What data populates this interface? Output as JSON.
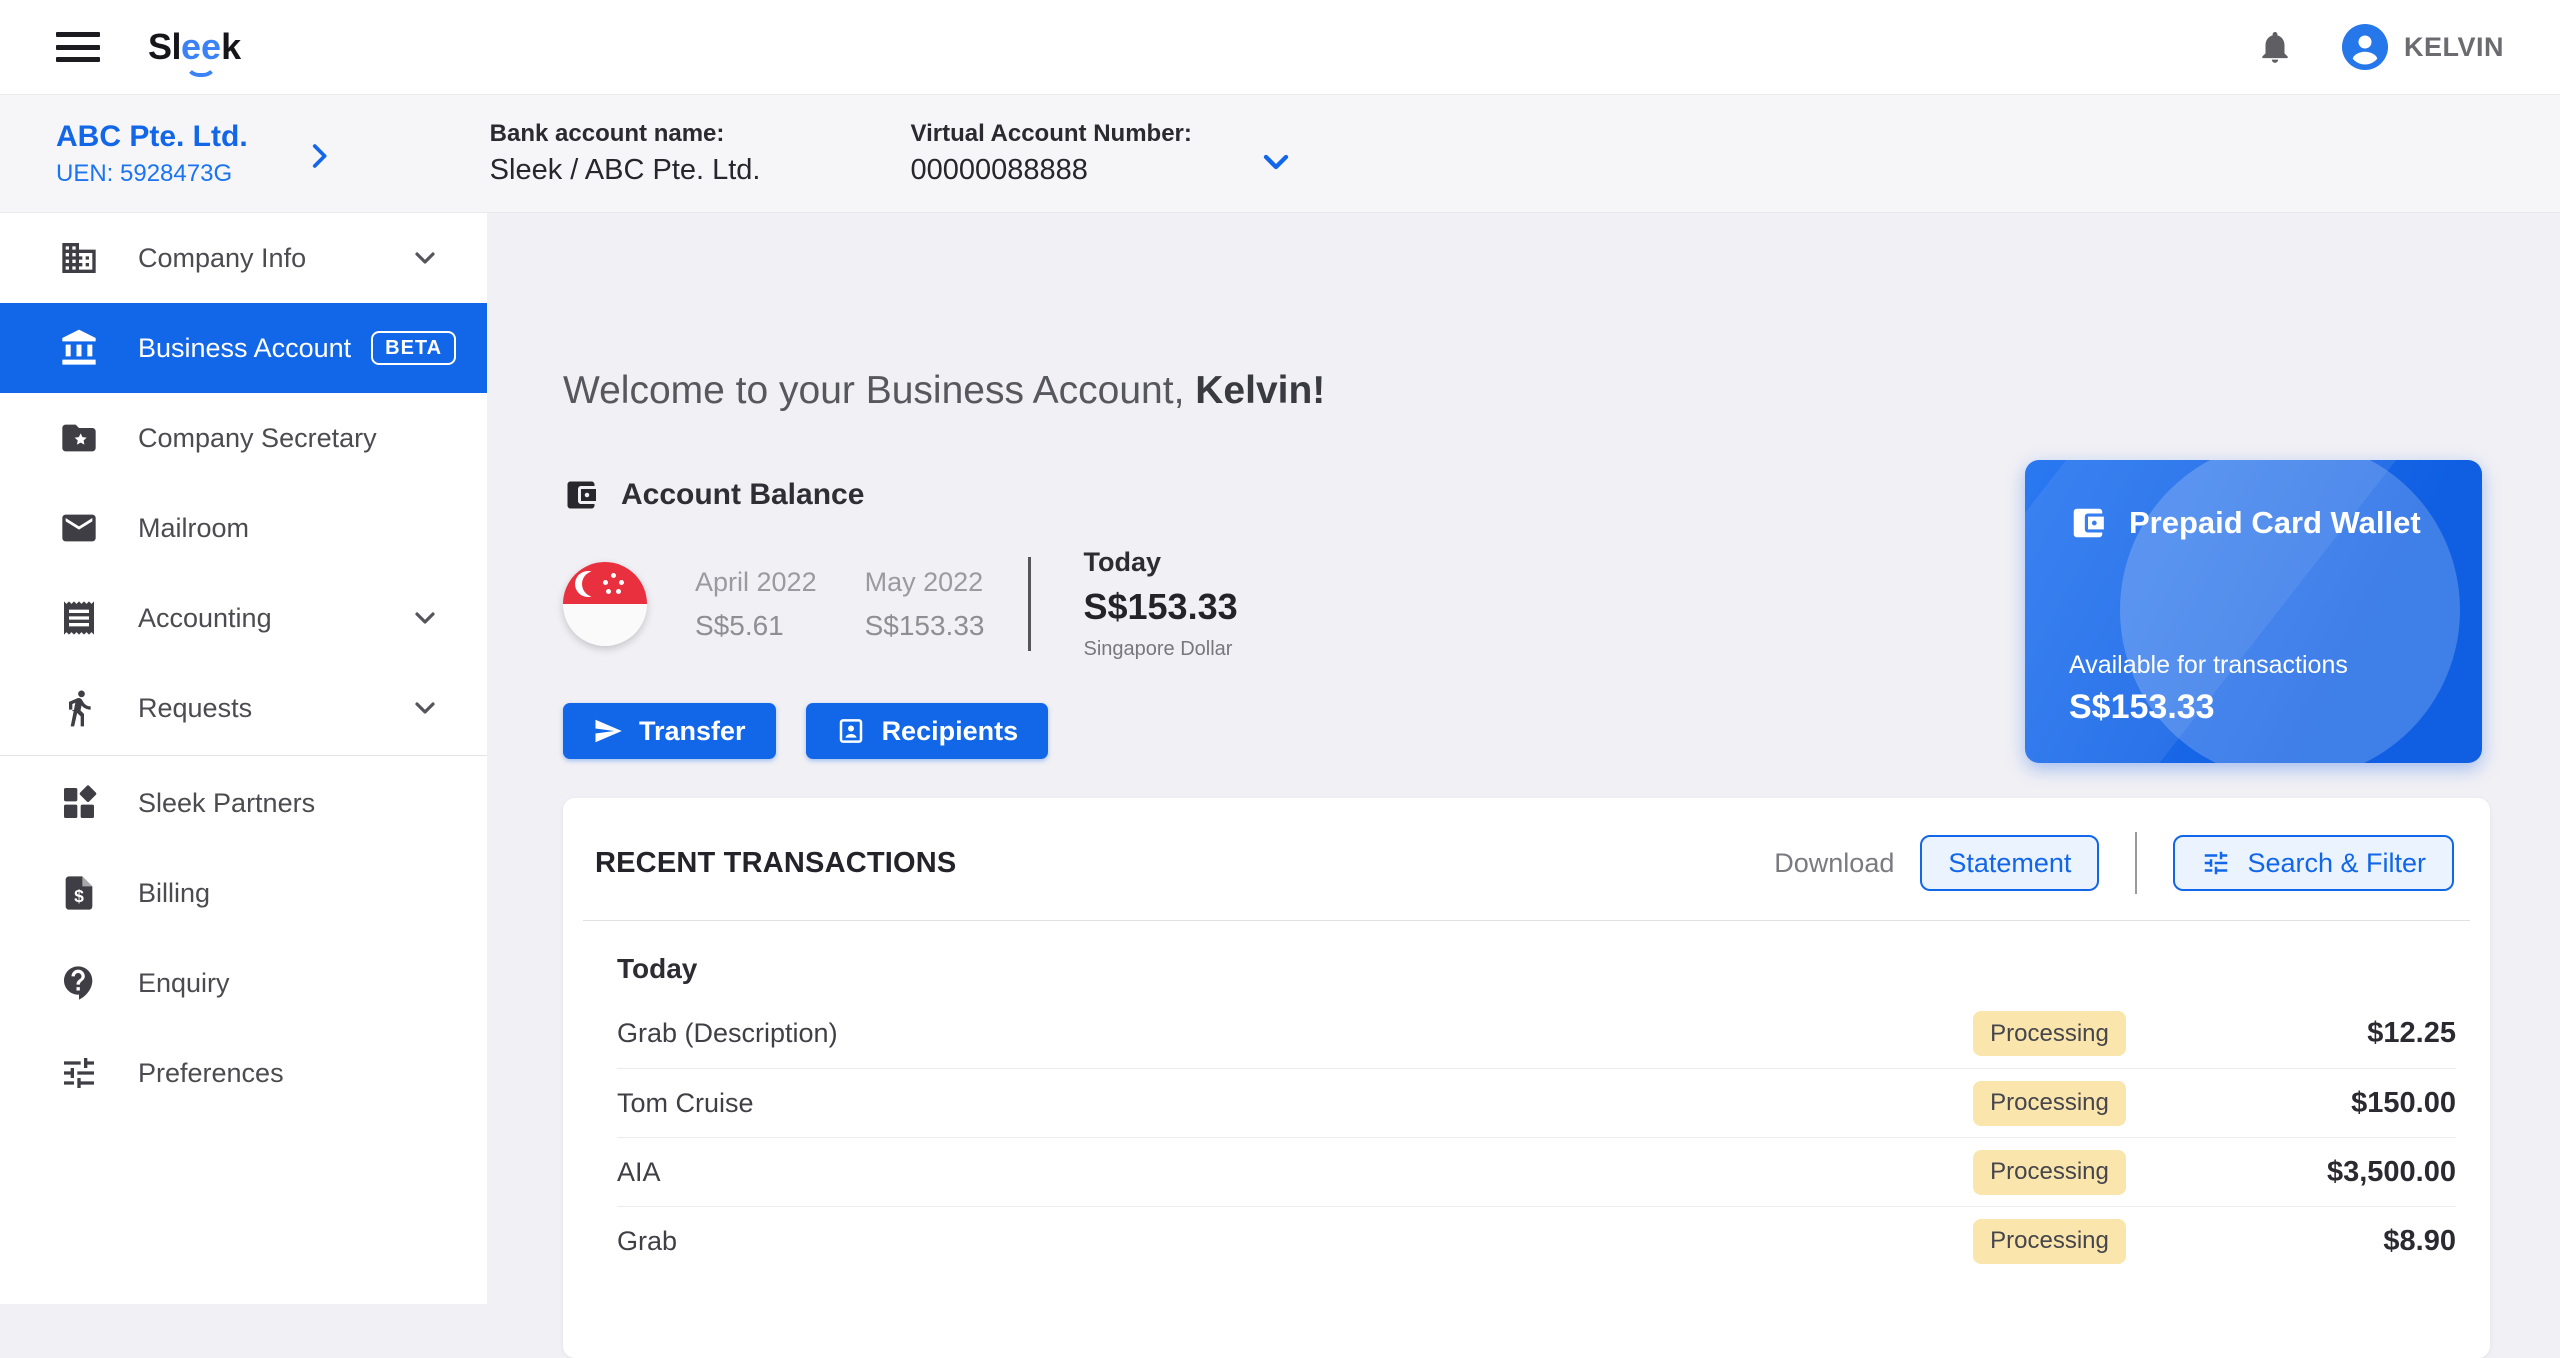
{
  "colors": {
    "primary_blue": "#1266E8",
    "badge_bg": "#FAE6AC",
    "badge_text": "#45454B",
    "flag_red": "#E8303E",
    "active_item_bg": "#1266E8"
  },
  "brand": {
    "logo_part1": "Sl",
    "logo_part2": "ee",
    "logo_part3": "k"
  },
  "topbar": {
    "user_name": "KELVIN"
  },
  "company_bar": {
    "company_name": "ABC Pte. Ltd.",
    "uen": "UEN: 5928473G",
    "bank_account_label": "Bank account name:",
    "bank_account_value": "Sleek / ABC Pte. Ltd.",
    "virtual_account_label": "Virtual Account Number:",
    "virtual_account_value": "00000088888"
  },
  "sidebar": {
    "items": [
      {
        "label": "Company Info",
        "icon": "building-icon",
        "chevron": true
      },
      {
        "label": "Business Account",
        "icon": "bank-icon",
        "badge": "BETA",
        "active": true
      },
      {
        "label": "Company Secretary",
        "icon": "folder-star-icon"
      },
      {
        "label": "Mailroom",
        "icon": "envelope-icon"
      },
      {
        "label": "Accounting",
        "icon": "receipt-icon",
        "chevron": true
      },
      {
        "label": "Requests",
        "icon": "walking-person-icon",
        "chevron": true
      },
      {
        "label": "Sleek Partners",
        "icon": "partners-grid-icon"
      },
      {
        "label": "Billing",
        "icon": "billing-document-icon"
      },
      {
        "label": "Enquiry",
        "icon": "question-bubble-icon"
      },
      {
        "label": "Preferences",
        "icon": "sliders-icon"
      }
    ]
  },
  "main": {
    "welcome_prefix": "Welcome to your Business Account, ",
    "welcome_name": "Kelvin!",
    "account_balance": {
      "title": "Account Balance",
      "history": [
        {
          "month": "April 2022",
          "amount": "S$5.61"
        },
        {
          "month": "May 2022",
          "amount": "S$153.33"
        }
      ],
      "today_label": "Today",
      "today_amount": "S$153.33",
      "currency": "Singapore Dollar"
    },
    "actions": {
      "transfer_label": "Transfer",
      "recipients_label": "Recipients"
    },
    "wallet_card": {
      "title": "Prepaid Card Wallet",
      "subtitle": "Available for transactions",
      "amount": "S$153.33"
    },
    "transactions": {
      "title": "RECENT TRANSACTIONS",
      "download_label": "Download",
      "statement_button": "Statement",
      "filter_button": "Search & Filter",
      "group_label": "Today",
      "rows": [
        {
          "name": "Grab (Description)",
          "status": "Processing",
          "amount": "$12.25"
        },
        {
          "name": "Tom Cruise",
          "status": "Processing",
          "amount": "$150.00"
        },
        {
          "name": "AIA",
          "status": "Processing",
          "amount": "$3,500.00"
        },
        {
          "name": "Grab",
          "status": "Processing",
          "amount": "$8.90"
        }
      ]
    }
  }
}
